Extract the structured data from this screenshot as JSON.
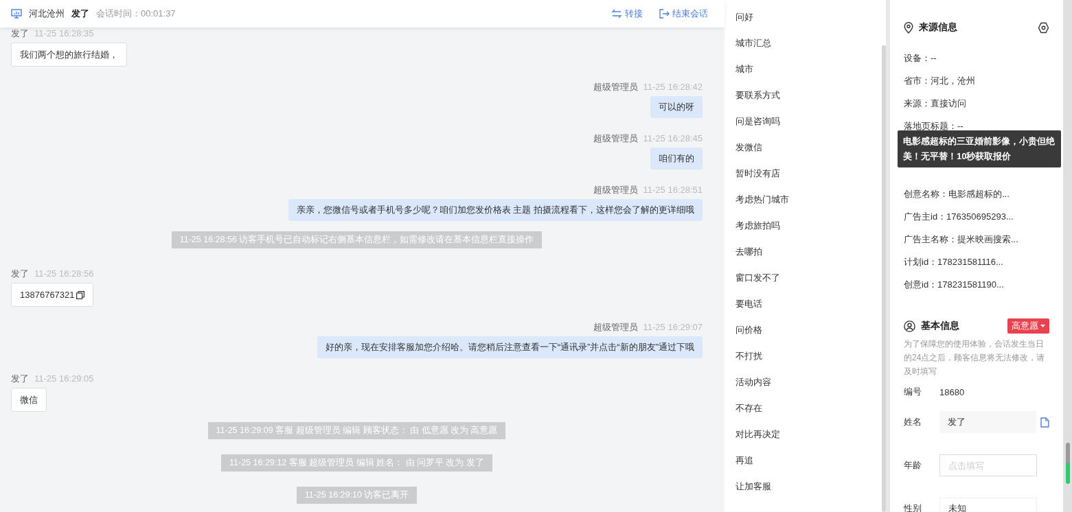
{
  "header": {
    "location": "河北沧州",
    "visitor": "发了",
    "duration_label": "会话时间：",
    "duration": "00:01:37",
    "actions": [
      {
        "kind": "transfer",
        "label": "转接"
      },
      {
        "kind": "end",
        "label": "结束会话"
      }
    ]
  },
  "messages": [
    {
      "kind": "visitor",
      "sender": "发了",
      "time": "11-25 16:28:35",
      "text": "我们两个想的旅行结婚，"
    },
    {
      "kind": "agent",
      "sender": "超级管理员",
      "time": "11-25 16:28:42",
      "text": "可以的呀"
    },
    {
      "kind": "agent",
      "sender": "超级管理员",
      "time": "11-25 16:28:45",
      "text": "咱们有的"
    },
    {
      "kind": "agent",
      "sender": "超级管理员",
      "time": "11-25 16:28:51",
      "text": "亲亲，您微信号或者手机号多少呢？咱们加您发价格表 主题 拍摄流程看下，这样您会了解的更详细哦"
    },
    {
      "kind": "system",
      "text": "11-25 16:28:56 访客手机号已自动标记右侧基本信息栏，如需修改请在基本信息栏直接操作"
    },
    {
      "kind": "visitor",
      "sender": "发了",
      "time": "11-25 16:28:56",
      "text": "13876767321",
      "copyable": true
    },
    {
      "kind": "agent",
      "sender": "超级管理员",
      "time": "11-25 16:29:07",
      "text": "好的亲，现在安排客服加您介绍哈。请您稍后注意查看一下“通讯录”并点击“新的朋友”通过下哦"
    },
    {
      "kind": "visitor",
      "sender": "发了",
      "time": "11-25 16:29:05",
      "text": "微信"
    },
    {
      "kind": "system",
      "text": "11-25 16:29:09 客服 超级管理员 编辑 顾客状态： 由 低意愿 改为 高意愿"
    },
    {
      "kind": "system",
      "text": "11-25 16:29:12 客服 超级管理员 编辑 姓名： 由 问罗平 改为 发了"
    },
    {
      "kind": "system",
      "text": "11-25 16:29:10 访客已离开"
    }
  ],
  "quick_replies": [
    "问好",
    "城市汇总",
    "城市",
    "要联系方式",
    "问是咨询吗",
    "发微信",
    "暂时没有店",
    "考虑热门城市",
    "考虑旅拍吗",
    "去哪拍",
    "窗口发不了",
    "要电话",
    "问价格",
    "不打扰",
    "活动内容",
    "不存在",
    "对比再决定",
    "再追",
    "让加客服"
  ],
  "source_info": {
    "title": "来源信息",
    "rows_top": [
      "设备：--",
      "省市：河北，沧州",
      "来源：直接访问",
      "落地页标题：--"
    ],
    "tooltip": "电影感超标的三亚婚前影像，小贵但绝美！无平替！10秒获取报价",
    "rows_bottom": [
      "创意名称：电影感超标的...",
      "广告主id：176350695293...",
      "广告主名称：提米映画搜索...",
      "计划id：178231581116...",
      "创意id：178231581190..."
    ]
  },
  "basic_info": {
    "title": "基本信息",
    "intent": "高意愿",
    "notice": "为了保障您的使用体验，会话发生当日的24点之后，顾客信息将无法修改，请及时填写",
    "fields": [
      {
        "kind": "static",
        "label": "编号",
        "value": "18680"
      },
      {
        "kind": "filled",
        "label": "姓名",
        "value": "发了"
      },
      {
        "kind": "input",
        "label": "年龄",
        "placeholder": "点击填写"
      },
      {
        "kind": "select",
        "label": "性别",
        "value": "未知"
      }
    ]
  }
}
